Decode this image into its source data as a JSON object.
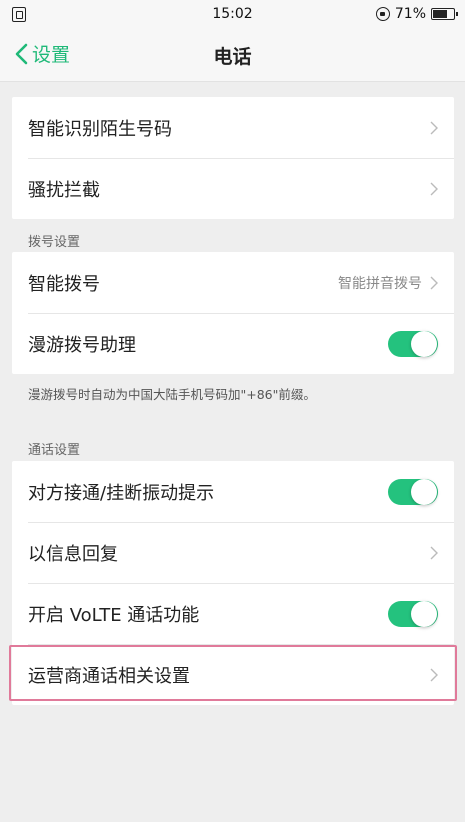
{
  "status": {
    "time": "15:02",
    "battery": "71%"
  },
  "nav": {
    "back_label": "设置",
    "title": "电话"
  },
  "group1": {
    "items": [
      {
        "label": "智能识别陌生号码"
      },
      {
        "label": "骚扰拦截"
      }
    ]
  },
  "dial": {
    "header": "拨号设置",
    "smart_dial_label": "智能拨号",
    "smart_dial_value": "智能拼音拨号",
    "roaming_label": "漫游拨号助理",
    "roaming_on": true,
    "note": "漫游拨号时自动为中国大陆手机号码加\"+86\"前缀。"
  },
  "call": {
    "header": "通话设置",
    "vibrate_label": "对方接通/挂断振动提示",
    "vibrate_on": true,
    "reply_label": "以信息回复",
    "volte_label": "开启 VoLTE 通话功能",
    "volte_on": true,
    "carrier_label": "运营商通话相关设置"
  },
  "colors": {
    "accent": "#1fb978",
    "toggle_on": "#24c27e",
    "highlight": "#e07a9a"
  }
}
